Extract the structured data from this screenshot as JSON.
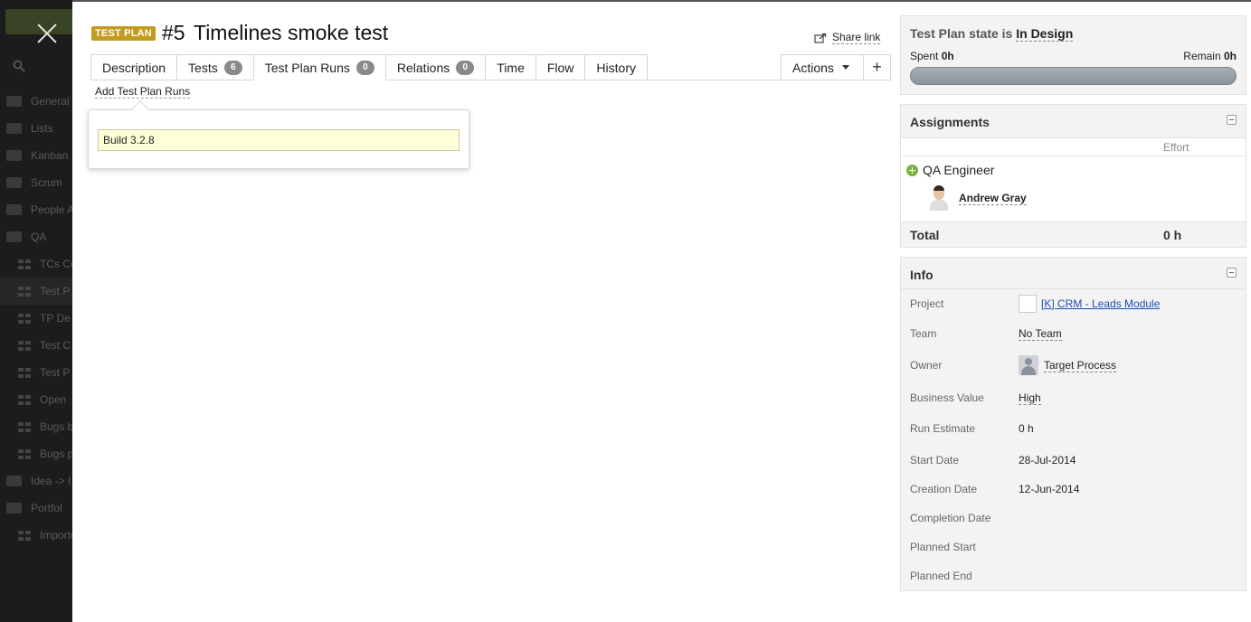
{
  "sidebar": {
    "items": [
      {
        "label": "General",
        "type": "folder"
      },
      {
        "label": "Lists",
        "type": "folder"
      },
      {
        "label": "Kanban",
        "type": "folder"
      },
      {
        "label": "Scrum",
        "type": "folder"
      },
      {
        "label": "People A",
        "type": "folder"
      },
      {
        "label": "QA",
        "type": "folder"
      },
      {
        "label": "TCs Co",
        "type": "view"
      },
      {
        "label": "Test P",
        "type": "view",
        "active": true
      },
      {
        "label": "TP De",
        "type": "view"
      },
      {
        "label": "Test C",
        "type": "view"
      },
      {
        "label": "Test P",
        "type": "view"
      },
      {
        "label": "Open",
        "type": "view"
      },
      {
        "label": "Bugs b",
        "type": "view"
      },
      {
        "label": "Bugs p",
        "type": "view"
      },
      {
        "label": "Idea -> I",
        "type": "folder"
      },
      {
        "label": "Portfol",
        "type": "folder"
      },
      {
        "label": "Importe",
        "type": "view"
      }
    ]
  },
  "header": {
    "badge": "TEST PLAN",
    "number": "#5",
    "title": "Timelines smoke test",
    "share_label": "Share link"
  },
  "tabs": [
    {
      "label": "Description"
    },
    {
      "label": "Tests",
      "count": "6"
    },
    {
      "label": "Test Plan Runs",
      "count": "0",
      "active": true
    },
    {
      "label": "Relations",
      "count": "0"
    },
    {
      "label": "Time"
    },
    {
      "label": "Flow"
    },
    {
      "label": "History"
    }
  ],
  "actions_label": "Actions",
  "plus_label": "+",
  "add_runs_label": "Add Test Plan Runs",
  "popup": {
    "input_value": "Build 3.2.8"
  },
  "state": {
    "prefix": "Test Plan state is",
    "value": "In Design",
    "spent_label": "Spent",
    "spent_value": "0h",
    "remain_label": "Remain",
    "remain_value": "0h"
  },
  "assignments": {
    "title": "Assignments",
    "effort_header": "Effort",
    "role": "QA Engineer",
    "person": "Andrew Gray",
    "total_label": "Total",
    "total_value": "0 h"
  },
  "info": {
    "title": "Info",
    "project_label": "Project",
    "project_value": "[K] CRM - Leads Module",
    "team_label": "Team",
    "team_value": "No Team",
    "owner_label": "Owner",
    "owner_value": "Target Process",
    "business_value_label": "Business Value",
    "business_value_value": "High",
    "run_estimate_label": "Run Estimate",
    "run_estimate_value": "0 h",
    "start_date_label": "Start Date",
    "start_date_value": "28-Jul-2014",
    "creation_date_label": "Creation Date",
    "creation_date_value": "12-Jun-2014",
    "completion_date_label": "Completion Date",
    "planned_start_label": "Planned Start",
    "planned_end_label": "Planned End"
  },
  "colors": {
    "badge": "#c39b1f",
    "link": "#1a4fb3",
    "add_role": "#78b43a",
    "input_bg": "#ffffd8"
  }
}
